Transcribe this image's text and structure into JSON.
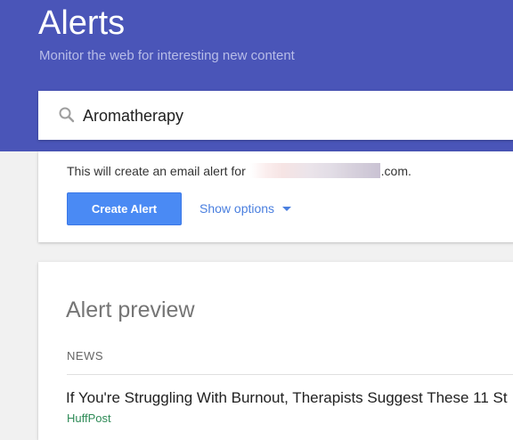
{
  "header": {
    "title": "Alerts",
    "subtitle": "Monitor the web for interesting new content",
    "background_color": "#4a55b8"
  },
  "search": {
    "value": "Aromatherapy",
    "icon": "search-icon"
  },
  "create_card": {
    "email_prefix": "This will create an email alert for",
    "email_suffix": ".com.",
    "create_button_label": "Create Alert",
    "show_options_label": "Show options",
    "button_color": "#4a8af4",
    "link_color": "#4a7fdf"
  },
  "preview": {
    "title": "Alert preview",
    "section_label": "NEWS",
    "articles": [
      {
        "title": "If You're Struggling With Burnout, Therapists Suggest These 11 St",
        "source": "HuffPost"
      }
    ]
  }
}
